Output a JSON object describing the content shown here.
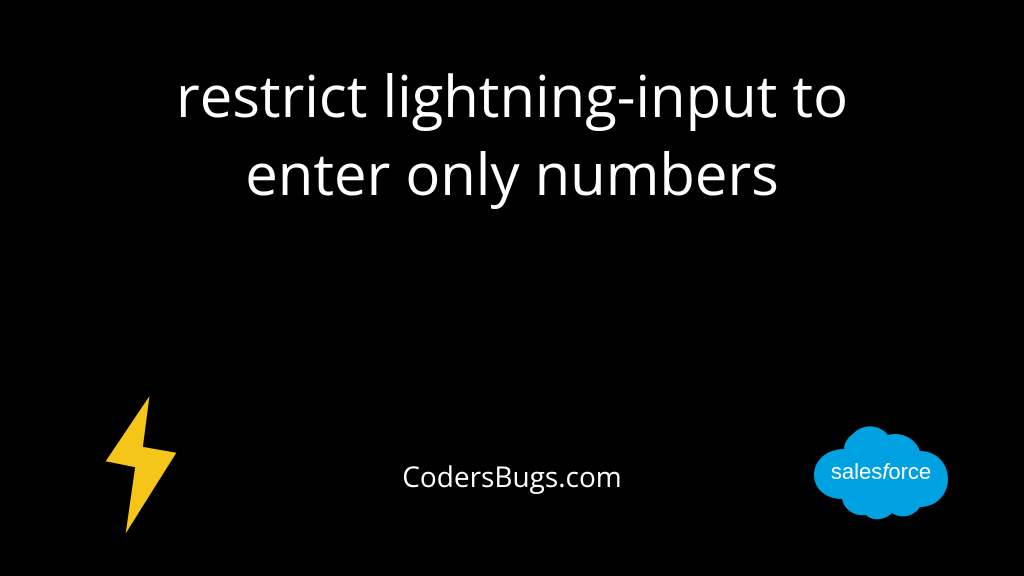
{
  "title_line1": "restrict lightning-input to",
  "title_line2": "enter only numbers",
  "domain_text": "CodersBugs.com",
  "salesforce_text": "salesforce",
  "colors": {
    "background": "#000000",
    "text": "#ffffff",
    "lightning_fill": "#F5C518",
    "lightning_stroke": "#000000",
    "salesforce_cloud": "#00A1E0"
  }
}
